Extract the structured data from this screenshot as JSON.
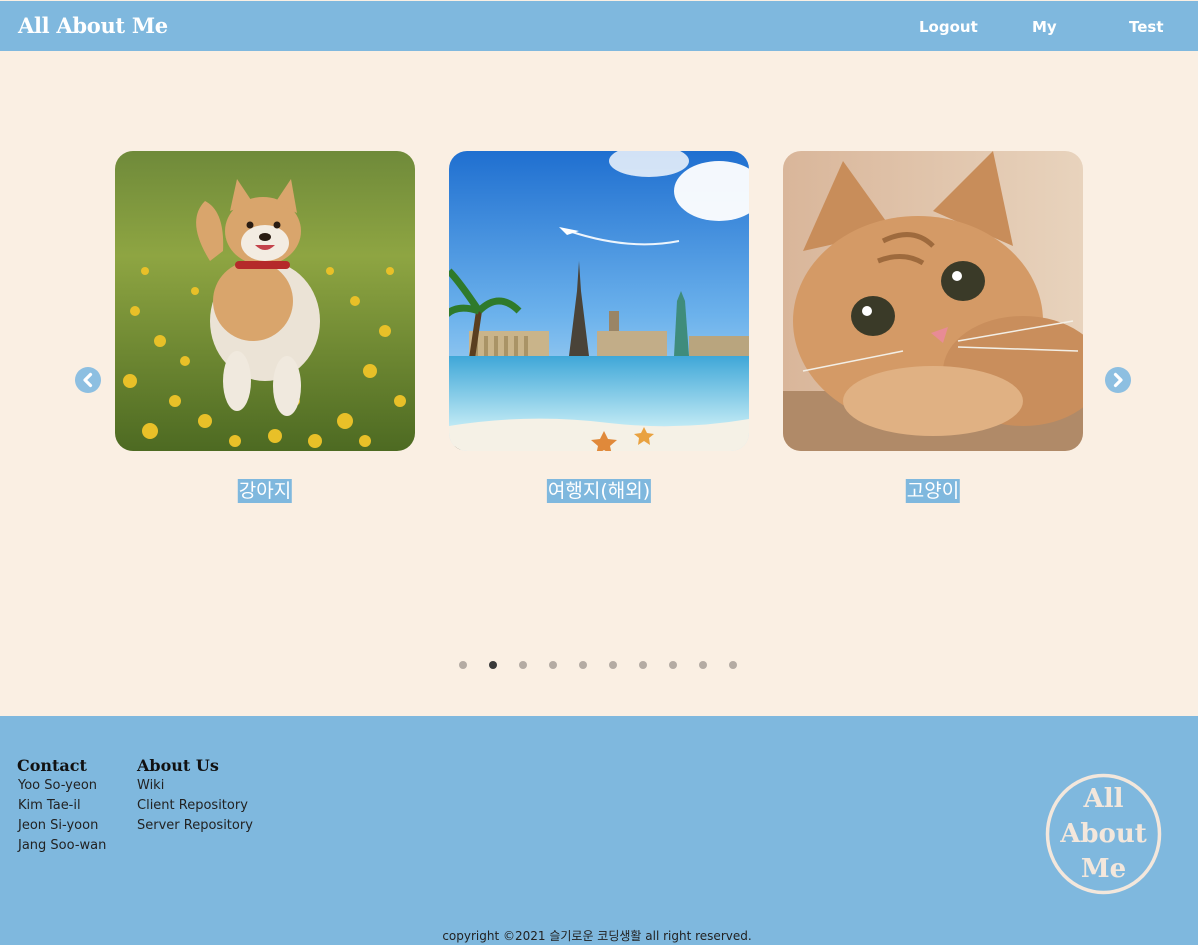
{
  "header": {
    "brand": "All About Me",
    "nav": {
      "logout": "Logout",
      "my": "My",
      "test": "Test"
    }
  },
  "carousel": {
    "cards": [
      {
        "caption": "강아지",
        "image": "shiba-dog-in-flower-field"
      },
      {
        "caption": "여행지(해외)",
        "image": "world-landmarks-beach"
      },
      {
        "caption": "고양이",
        "image": "orange-kitten"
      }
    ],
    "prev_icon": "chevron-left-circle-icon",
    "next_icon": "chevron-right-circle-icon",
    "dots_count": 10,
    "active_dot": 1
  },
  "footer": {
    "contact": {
      "title": "Contact",
      "items": [
        "Yoo So-yeon",
        "Kim Tae-il",
        "Jeon Si-yoon",
        "Jang Soo-wan"
      ]
    },
    "about": {
      "title": "About Us",
      "items": [
        "Wiki",
        "Client Repository",
        "Server Repository"
      ]
    },
    "logo_lines": [
      "All",
      "About",
      "Me"
    ],
    "copyright": "copyright ©2021 슬기로운 코딩생활 all right reserved."
  },
  "colors": {
    "header_bg": "#7fb8de",
    "page_bg": "#faefe3",
    "caption_highlight": "#7fb8de",
    "dot_active": "#3a3a3a",
    "dot_inactive": "#b4aba3"
  }
}
